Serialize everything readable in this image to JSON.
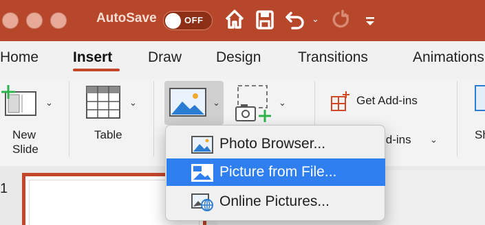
{
  "titlebar": {
    "autosave_label": "AutoSave",
    "autosave_state": "OFF",
    "colors": {
      "brand": "#b7472a"
    },
    "icons": [
      "home-icon",
      "save-icon",
      "undo-icon",
      "redo-icon",
      "customize-toolbar-icon"
    ]
  },
  "tabs": [
    {
      "label": "Home",
      "active": false
    },
    {
      "label": "Insert",
      "active": true
    },
    {
      "label": "Draw",
      "active": false
    },
    {
      "label": "Design",
      "active": false
    },
    {
      "label": "Transitions",
      "active": false
    },
    {
      "label": "Animations",
      "active": false
    }
  ],
  "ribbon": {
    "new_slide": {
      "line1": "New",
      "line2": "Slide"
    },
    "table": {
      "label": "Table"
    },
    "get_addins": {
      "label": "Get Add-ins"
    },
    "my_addins": {
      "label": "Add-ins"
    },
    "cut_off_label": "Sh"
  },
  "slides": {
    "number": "1"
  },
  "picture_menu": {
    "items": [
      {
        "label": "Photo Browser...",
        "icon": "photo-browser-icon",
        "selected": false
      },
      {
        "label": "Picture from File...",
        "icon": "picture-file-icon",
        "selected": true
      },
      {
        "label": "Online Pictures...",
        "icon": "online-pictures-icon",
        "selected": false
      }
    ]
  },
  "colors": {
    "accent": "#c3462a",
    "selection": "#2f7ff0"
  }
}
